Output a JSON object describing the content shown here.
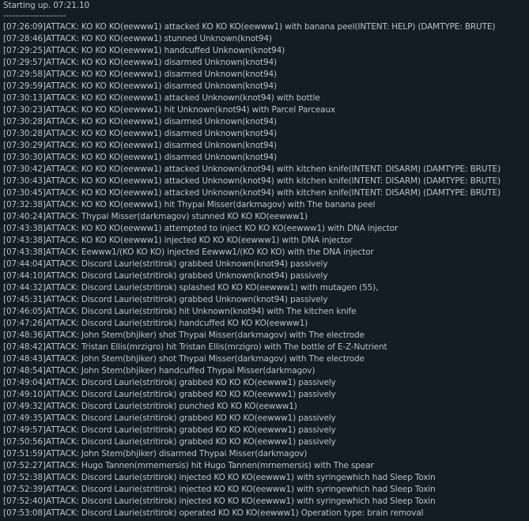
{
  "header": "Starting up. 07:21.10",
  "divider": "---------------------",
  "lines": [
    "[07:26:09]ATTACK: KO KO KO(eewww1) attacked KO KO KO(eewww1) with banana peel(INTENT: HELP) (DAMTYPE: BRUTE)",
    "[07:28:46]ATTACK: KO KO KO(eewww1) stunned Unknown(knot94)",
    "[07:29:25]ATTACK: KO KO KO(eewww1) handcuffed Unknown(knot94)",
    "[07:29:57]ATTACK: KO KO KO(eewww1) disarmed Unknown(knot94)",
    "[07:29:58]ATTACK: KO KO KO(eewww1) disarmed Unknown(knot94)",
    "[07:29:59]ATTACK: KO KO KO(eewww1) disarmed Unknown(knot94)",
    "[07:30:13]ATTACK: KO KO KO(eewww1) attacked Unknown(knot94) with bottle",
    "[07:30:23]ATTACK: KO KO KO(eewww1) hit Unknown(knot94) with Parcel Parceaux",
    "[07:30:28]ATTACK: KO KO KO(eewww1) disarmed Unknown(knot94)",
    "[07:30:28]ATTACK: KO KO KO(eewww1) disarmed Unknown(knot94)",
    "[07:30:29]ATTACK: KO KO KO(eewww1) disarmed Unknown(knot94)",
    "[07:30:30]ATTACK: KO KO KO(eewww1) disarmed Unknown(knot94)",
    "[07:30:42]ATTACK: KO KO KO(eewww1) attacked Unknown(knot94) with kitchen knife(INTENT: DISARM) (DAMTYPE: BRUTE)",
    "[07:30:43]ATTACK: KO KO KO(eewww1) attacked Unknown(knot94) with kitchen knife(INTENT: DISARM) (DAMTYPE: BRUTE)",
    "[07:30:45]ATTACK: KO KO KO(eewww1) attacked Unknown(knot94) with kitchen knife(INTENT: DISARM) (DAMTYPE: BRUTE)",
    "[07:32:38]ATTACK: KO KO KO(eewww1) hit Thypai Misser(darkmagov) with The banana peel",
    "[07:40:24]ATTACK: Thypai Misser(darkmagov) stunned KO KO KO(eewww1)",
    "[07:43:38]ATTACK: KO KO KO(eewww1) attempted to inject KO KO KO(eewww1) with DNA injector",
    "[07:43:38]ATTACK: KO KO KO(eewww1) injected KO KO KO(eewww1) with DNA injector",
    "[07:43:38]ATTACK: Eewww1/(KO KO KO) injected Eewww1/(KO KO KO) with the DNA injector",
    "[07:44:04]ATTACK: Discord Laurie(stritirok) grabbed Unknown(knot94) passively",
    "[07:44:10]ATTACK: Discord Laurie(stritirok) grabbed Unknown(knot94) passively",
    "[07:44:32]ATTACK: Discord Laurie(stritirok) splashed KO KO KO(eewww1) with mutagen (55),",
    "[07:45:31]ATTACK: Discord Laurie(stritirok) grabbed Unknown(knot94) passively",
    "[07:46:05]ATTACK: Discord Laurie(stritirok) hit Unknown(knot94) with The kitchen knife",
    "[07:47:26]ATTACK: Discord Laurie(stritirok) handcuffed KO KO KO(eewww1)",
    "[07:48:36]ATTACK: John Stem(bhjiker) shot Thypai Misser(darkmagov) with The electrode",
    "[07:48:42]ATTACK: Tristan Ellis(mrzigro) hit Tristan Ellis(mrzigro) with The bottle of E-Z-Nutrient",
    "[07:48:43]ATTACK: John Stem(bhjiker) shot Thypai Misser(darkmagov) with The electrode",
    "[07:48:54]ATTACK: John Stem(bhjiker) handcuffed Thypai Misser(darkmagov)",
    "[07:49:04]ATTACK: Discord Laurie(stritirok) grabbed KO KO KO(eewww1) passively",
    "[07:49:10]ATTACK: Discord Laurie(stritirok) grabbed KO KO KO(eewww1) passively",
    "[07:49:32]ATTACK: Discord Laurie(stritirok) punched KO KO KO(eewww1)",
    "[07:49:35]ATTACK: Discord Laurie(stritirok) grabbed KO KO KO(eewww1) passively",
    "[07:49:57]ATTACK: Discord Laurie(stritirok) grabbed KO KO KO(eewww1) passively",
    "[07:50:56]ATTACK: Discord Laurie(stritirok) grabbed KO KO KO(eewww1) passively",
    "[07:51:59]ATTACK: John Stem(bhjiker) disarmed Thypai Misser(darkmagov)",
    "[07:52:27]ATTACK: Hugo Tannen(mrnemersis) hit Hugo Tannen(mrnemersis) with The spear",
    "[07:52:38]ATTACK: Discord Laurie(stritirok) injected KO KO KO(eewww1) with syringewhich had Sleep Toxin",
    "[07:52:39]ATTACK: Discord Laurie(stritirok) injected KO KO KO(eewww1) with syringewhich had Sleep Toxin",
    "[07:52:40]ATTACK: Discord Laurie(stritirok) injected KO KO KO(eewww1) with syringewhich had Sleep Toxin",
    "[07:53:08]ATTACK: Discord Laurie(stritirok) operated KO KO KO(eewww1) Operation type: brain removal"
  ]
}
